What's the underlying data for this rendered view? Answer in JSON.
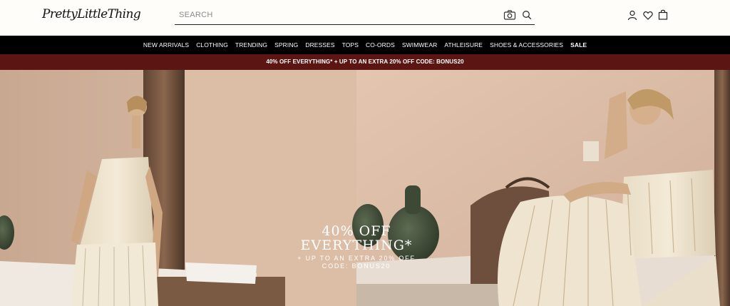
{
  "header": {
    "logo_text": "PrettyLittleThing",
    "search_placeholder": "SEARCH",
    "icons": [
      "camera-icon",
      "search-icon",
      "user-icon",
      "heart-icon",
      "bag-icon"
    ]
  },
  "nav": {
    "items": [
      "NEW ARRIVALS",
      "CLOTHING",
      "TRENDING",
      "SPRING",
      "DRESSES",
      "TOPS",
      "CO-ORDS",
      "SWIMWEAR",
      "ATHLEISURE",
      "SHOES & ACCESSORIES",
      "SALE"
    ]
  },
  "promo": {
    "text": "40% OFF EVERYTHING* + UP TO AN EXTRA 20% OFF CODE: BONUS20"
  },
  "hero": {
    "headline_1": "40% OFF",
    "headline_2": "EVERYTHING*",
    "subline": "+ UP TO AN EXTRA 20% OFF",
    "code": "CODE: BONUS20"
  },
  "colors": {
    "nav_bg": "#000000",
    "promo_bg": "#5b1614",
    "header_bg": "#fffdf9"
  }
}
